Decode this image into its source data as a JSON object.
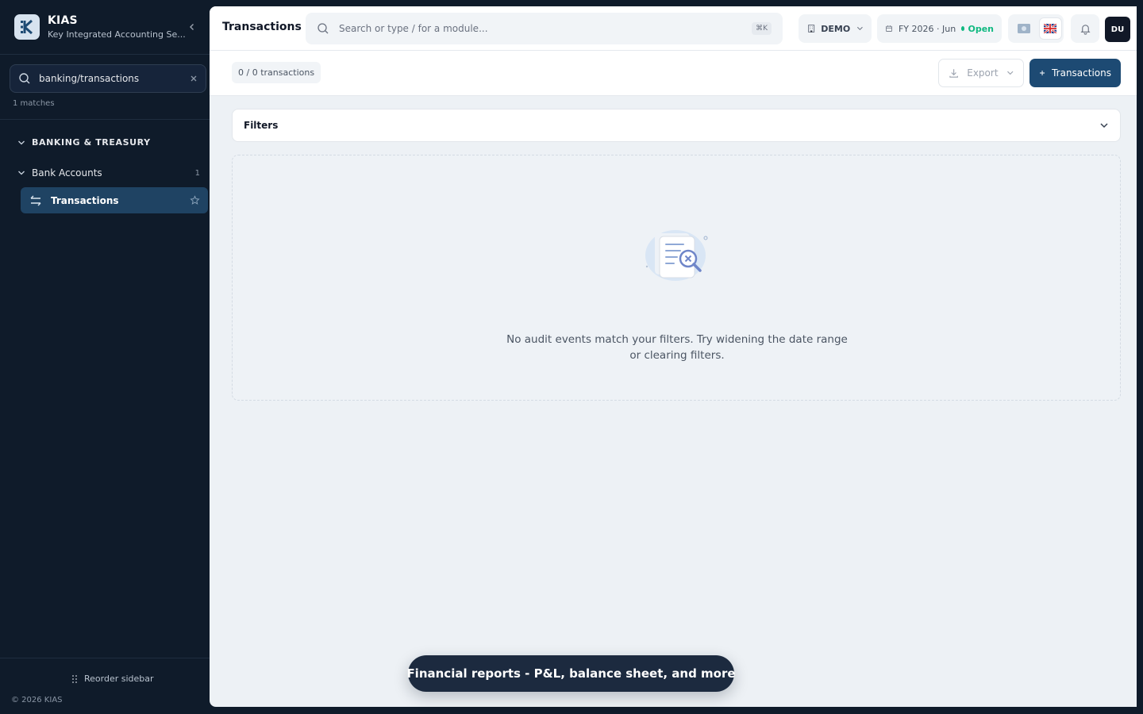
{
  "brand": {
    "name": "KIAS",
    "subtitle": "Key Integrated Accounting Se..."
  },
  "sidebar": {
    "search_value": "banking/transactions",
    "matches": "1 matches",
    "section": "BANKING & TREASURY",
    "group": {
      "label": "Bank Accounts",
      "count": "1"
    },
    "item": {
      "label": "Transactions"
    },
    "reorder": "Reorder sidebar",
    "copyright": "© 2026 KIAS"
  },
  "header": {
    "title": "Transactions",
    "search_placeholder": "Search or type / for a module...",
    "shortcut": "⌘K",
    "company": "DEMO",
    "period": "FY 2026 · Jun",
    "period_status": "Open",
    "avatar_initials": "DU"
  },
  "toolbar": {
    "count": "0 / 0 transactions",
    "export_label": "Export",
    "primary_label": "Transactions"
  },
  "filters": {
    "label": "Filters"
  },
  "empty_state": {
    "message": "No audit events match your filters. Try widening the date range or clearing filters."
  },
  "toast": {
    "text": "Financial reports - P&L, balance sheet, and more"
  },
  "colors": {
    "sidebar_bg": "#0f1b2a",
    "active_item": "#1f4363",
    "primary": "#1d4a73",
    "status_open": "#10b981"
  },
  "icons": [
    "logo-icon",
    "chevron-left-icon",
    "search-icon",
    "close-icon",
    "chevron-down-icon",
    "transfer-icon",
    "star-icon",
    "grip-icon",
    "building-icon",
    "calendar-icon",
    "flag-icon",
    "bell-icon",
    "download-icon",
    "plus-icon",
    "empty-search-illustration"
  ]
}
